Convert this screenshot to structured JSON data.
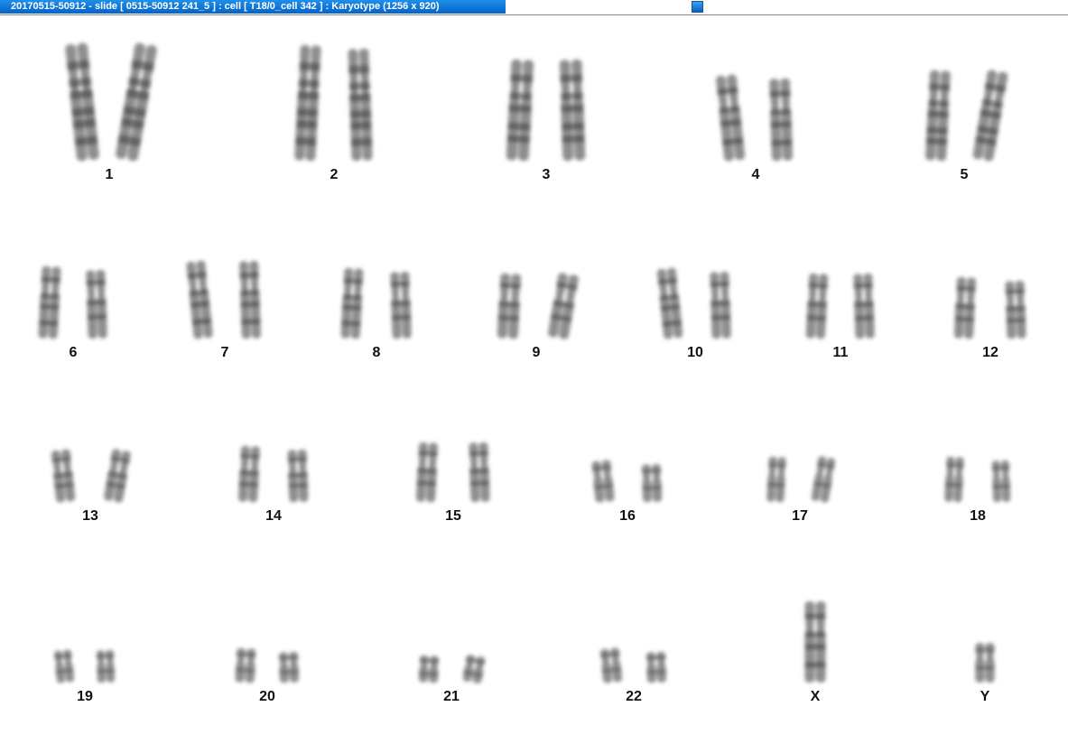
{
  "window": {
    "title": "20170515-50912 - slide [ 0515-50912 241_5 ] : cell [ T18/0_cell 342 ] : Karyotype  (1256 x 920)"
  },
  "karyotype": {
    "chromosomes": [
      "1",
      "2",
      "3",
      "4",
      "5",
      "6",
      "7",
      "8",
      "9",
      "10",
      "11",
      "12",
      "13",
      "14",
      "15",
      "16",
      "17",
      "18",
      "19",
      "20",
      "21",
      "22",
      "X",
      "Y"
    ]
  },
  "colors": {
    "title_bar": "#0563c9",
    "chromosome": "#7a7a7a",
    "band": "#3c3c3c"
  }
}
